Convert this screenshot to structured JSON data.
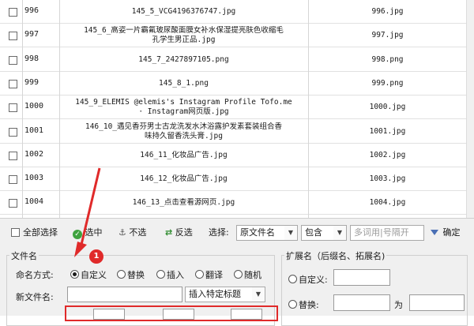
{
  "rows": [
    {
      "id": "996",
      "name": [
        "145_5_VCG4196376747.jpg"
      ],
      "ext": "996.jpg"
    },
    {
      "id": "997",
      "name": [
        "145_6_高姿一片霸氟玻尿酸面膜女补水保湿提亮肤色收缩毛",
        "孔学生男正品.jpg"
      ],
      "ext": "997.jpg"
    },
    {
      "id": "998",
      "name": [
        "145_7_2427897105.png"
      ],
      "ext": "998.png"
    },
    {
      "id": "999",
      "name": [
        "145_8_1.png"
      ],
      "ext": "999.png"
    },
    {
      "id": "1000",
      "name": [
        "145_9_ELEMIS  @elemis's Instagram Profile  Tofo.me",
        "· Instagram网页版.jpg"
      ],
      "ext": "1000.jpg"
    },
    {
      "id": "1001",
      "name": [
        "146_10_遇见香芬男士古龙洗发水沐浴露护发素套装组合香",
        "味持久留香洗头膏.jpg"
      ],
      "ext": "1001.jpg"
    },
    {
      "id": "1002",
      "name": [
        "146_11_化妆品广告.jpg"
      ],
      "ext": "1002.jpg"
    },
    {
      "id": "1003",
      "name": [
        "146_12_化妆品广告.jpg"
      ],
      "ext": "1003.jpg"
    },
    {
      "id": "1004",
      "name": [
        "146_13_点击查看源网页.jpg"
      ],
      "ext": "1004.jpg"
    }
  ],
  "toolbar": {
    "select_all": "全部选择",
    "select": "选中",
    "deselect": "不选",
    "invert": "反选",
    "choose_label": "选择:",
    "field_value": "原文件名",
    "match_value": "包含",
    "keyword_placeholder": "多词用|号隔开",
    "confirm": "确定"
  },
  "filename_group": {
    "title": "文件名",
    "mode_label": "命名方式:",
    "modes": [
      "自定义",
      "替换",
      "插入",
      "翻译",
      "随机"
    ],
    "selected_mode": "自定义",
    "new_name_label": "新文件名:",
    "insert_title": "插入特定标题"
  },
  "ext_group": {
    "title": "扩展名（后缀名、拓展名)",
    "custom": "自定义:",
    "replace": "替换:",
    "replace_with": "为"
  },
  "annotation": {
    "badge": "1",
    "color": "#e02a2a"
  }
}
